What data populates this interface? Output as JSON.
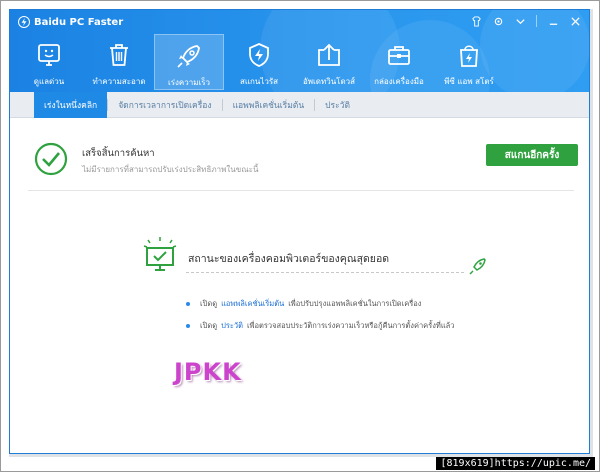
{
  "app": {
    "title": "Baidu PC Faster"
  },
  "nav": [
    {
      "label": "ดูแลด่วน",
      "icon": "monitor-smile-icon"
    },
    {
      "label": "ทำความสะอาด",
      "icon": "trash-icon"
    },
    {
      "label": "เร่งความเร็ว",
      "icon": "rocket-icon"
    },
    {
      "label": "สแกนไวรัส",
      "icon": "shield-lightning-icon"
    },
    {
      "label": "อัพเดทวินโดวส์",
      "icon": "upload-window-icon"
    },
    {
      "label": "กล่องเครื่องมือ",
      "icon": "toolbox-icon"
    },
    {
      "label": "พีซี แอพ สโตร์",
      "icon": "shopping-bag-icon"
    }
  ],
  "tabs": [
    "เร่งในหนึ่งคลิก",
    "จัดการเวลาการเปิดเครื่อง",
    "แอพพลิเคชั่นเริ่มต้น",
    "ประวัติ"
  ],
  "result": {
    "title": "เสร็จสิ้นการค้นหา",
    "subtitle": "ไม่มีรายการที่สามารถปรับเร่งประสิทธิภาพในขณะนี้",
    "button": "สแกนอีกครั้ง"
  },
  "status": {
    "text": "สถานะของเครื่องคอมพิวเตอร์ของคุณสุดยอด"
  },
  "bullets": [
    {
      "prefix": "เปิดดู",
      "link": "แอพพลิเคชั่นเริ่มต้น",
      "suffix": "เพื่อปรับปรุงแอพพลิเคชั่นในการเปิดเครื่อง"
    },
    {
      "prefix": "เปิดดู",
      "link": "ประวัติ",
      "suffix": "เพื่อตรวจสอบประวัติการเร่งความเร็วหรือกู้คืนการตั้งค่าครั้งที่แล้ว"
    }
  ],
  "watermark": "JPKK",
  "footer": {
    "size": "[819x619]",
    "site": "https://upic.me/"
  },
  "colors": {
    "header": "#1b82e3",
    "accent": "#2fa23f",
    "link": "#1b6fd6"
  }
}
